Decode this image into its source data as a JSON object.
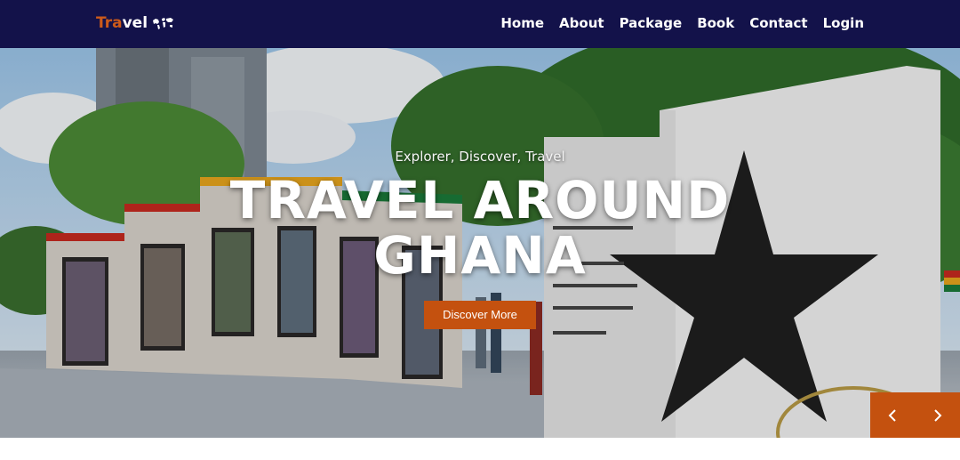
{
  "brand": {
    "accent": "Tra",
    "rest": "vel",
    "icon": "world-map-icon"
  },
  "nav": {
    "items": [
      {
        "label": "Home"
      },
      {
        "label": "About"
      },
      {
        "label": "Package"
      },
      {
        "label": "Book"
      },
      {
        "label": "Contact"
      },
      {
        "label": "Login"
      }
    ]
  },
  "hero": {
    "subtitle": "Explorer, Discover, Travel",
    "title_line1": "TRAVEL AROUND",
    "title_line2": "GHANA",
    "cta_label": "Discover More",
    "image_subject": "Ghana monument wall with portraits, star sculpture and quote"
  },
  "carousel": {
    "prev_icon": "chevron-left-icon",
    "next_icon": "chevron-right-icon"
  },
  "colors": {
    "navbar": "#13124a",
    "accent": "#c4510f",
    "text_light": "#ffffff"
  }
}
